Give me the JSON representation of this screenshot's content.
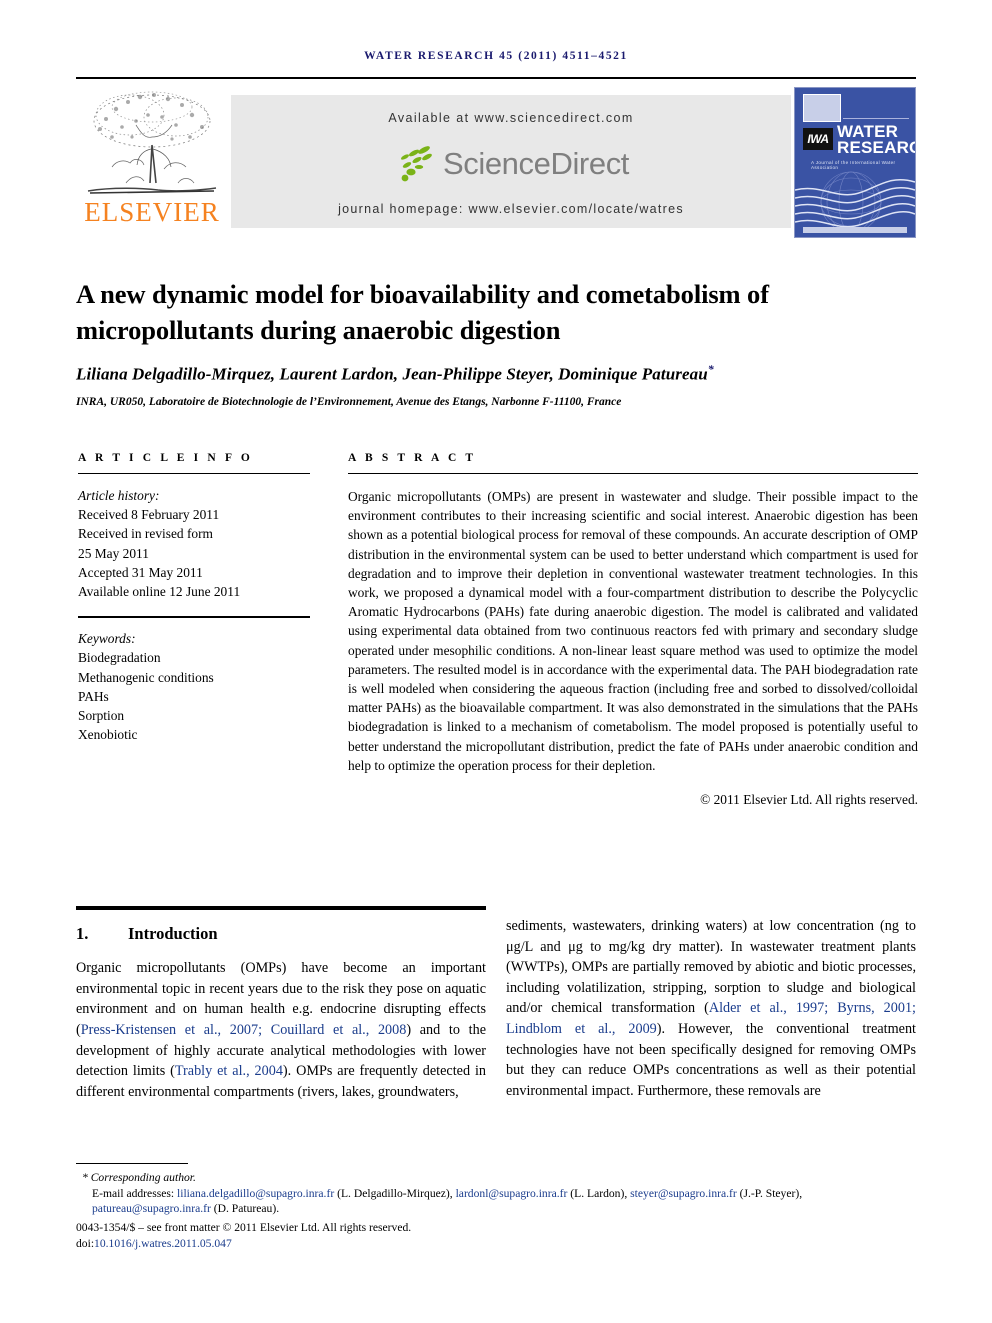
{
  "running_head": "Water Research 45 (2011) 4511–4521",
  "masthead": {
    "publisher_name": "ELSEVIER",
    "available_at": "Available at www.sciencedirect.com",
    "sciencedirect_word": "ScienceDirect",
    "journal_homepage": "journal homepage: www.elsevier.com/locate/watres",
    "cover": {
      "iwa_label": "IWA",
      "title_line1": "WATER",
      "title_line2": "RESEARCH",
      "subtitle": "A Journal of the International Water Association"
    },
    "colors": {
      "elsevier_orange": "#F58220",
      "banner_grey": "#e8e8e8",
      "sciencedirect_grey": "#7f7f7f",
      "leaf_green": "#7ab317",
      "cover_blue": "#3a53a4",
      "running_head_navy": "#1a1a6e",
      "citation_blue": "#1a3c8c"
    }
  },
  "article": {
    "title": "A new dynamic model for bioavailability and cometabolism of micropollutants during anaerobic digestion",
    "authors": "Liliana Delgadillo-Mirquez, Laurent Lardon, Jean-Philippe Steyer, Dominique Patureau",
    "author_marker": "*",
    "affiliation": "INRA, UR050, Laboratoire de Biotechnologie de l’Environnement, Avenue des Etangs, Narbonne F-11100, France"
  },
  "article_info": {
    "heading": "A R T I C L E   I N F O",
    "history_label": "Article history:",
    "history": [
      "Received 8 February 2011",
      "Received in revised form",
      "25 May 2011",
      "Accepted 31 May 2011",
      "Available online 12 June 2011"
    ],
    "keywords_label": "Keywords:",
    "keywords": [
      "Biodegradation",
      "Methanogenic conditions",
      "PAHs",
      "Sorption",
      "Xenobiotic"
    ]
  },
  "abstract": {
    "heading": "A B S T R A C T",
    "text": "Organic micropollutants (OMPs) are present in wastewater and sludge. Their possible impact to the environment contributes to their increasing scientific and social interest. Anaerobic digestion has been shown as a potential biological process for removal of these compounds. An accurate description of OMP distribution in the environmental system can be used to better understand which compartment is used for degradation and to improve their depletion in conventional wastewater treatment technologies. In this work, we proposed a dynamical model with a four-compartment distribution to describe the Polycyclic Aromatic Hydrocarbons (PAHs) fate during anaerobic digestion. The model is calibrated and validated using experimental data obtained from two continuous reactors fed with primary and secondary sludge operated under mesophilic conditions. A non-linear least square method was used to optimize the model parameters. The resulted model is in accordance with the experimental data. The PAH biodegradation rate is well modeled when considering the aqueous fraction (including free and sorbed to dissolved/colloidal matter PAHs) as the bioavailable compartment. It was also demonstrated in the simulations that the PAHs biodegradation is linked to a mechanism of cometabolism. The model proposed is potentially useful to better understand the micropollutant distribution, predict the fate of PAHs under anaerobic condition and help to optimize the operation process for their depletion.",
    "copyright": "© 2011 Elsevier Ltd. All rights reserved."
  },
  "introduction": {
    "number": "1.",
    "heading": "Introduction",
    "left_paragraph_part1": "Organic micropollutants (OMPs) have become an important environmental topic in recent years due to the risk they pose on aquatic environment and on human health e.g. endocrine disrupting effects (",
    "cite1": "Press-Kristensen et al., 2007; Couillard et al., 2008",
    "left_part2": ") and to the development of highly accurate analytical methodologies with lower detection limits (",
    "cite2": "Trably et al., 2004",
    "left_part3": "). OMPs are frequently detected in different environmental compartments (rivers, lakes, groundwaters,",
    "right_part1": "sediments, wastewaters, drinking waters) at low concentration (ng to μg/L and μg to mg/kg dry matter). In wastewater treatment plants (WWTPs), OMPs are partially removed by abiotic and biotic processes, including volatilization, stripping, sorption to sludge and biological and/or chemical transformation (",
    "cite3": "Alder et al., 1997; Byrns, 2001; Lindblom et al., 2009",
    "right_part2": "). However, the conventional treatment technologies have not been specifically designed for removing OMPs but they can reduce OMPs concentrations as well as their potential environmental impact. Furthermore, these removals are"
  },
  "footnote": {
    "corresponding_marker": "*",
    "corresponding_label": "Corresponding author.",
    "emails_label": "E-mail addresses:",
    "emails": [
      {
        "address": "liliana.delgadillo@supagro.inra.fr",
        "name": "(L. Delgadillo-Mirquez)"
      },
      {
        "address": "lardonl@supagro.inra.fr",
        "name": "(L. Lardon)"
      },
      {
        "address": "steyer@supagro.inra.fr",
        "name": "(J.-P. Steyer)"
      },
      {
        "address": "patureau@supagro.inra.fr",
        "name": "(D. Patureau)."
      }
    ],
    "issn_line": "0043-1354/$ – see front matter © 2011 Elsevier Ltd. All rights reserved.",
    "doi_prefix": "doi:",
    "doi_value": "10.1016/j.watres.2011.05.047"
  }
}
